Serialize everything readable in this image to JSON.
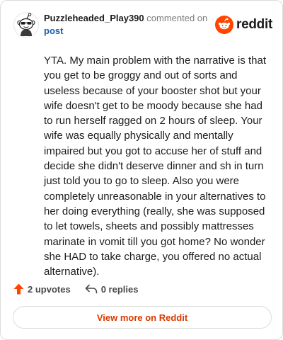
{
  "header": {
    "username": "Puzzleheaded_Play390",
    "commented_text": "commented on",
    "post_link": "post",
    "brand_name": "reddit"
  },
  "comment": {
    "body": "YTA. My main problem with the narrative is that you get to be groggy and out of sorts and useless because of your booster shot but your wife doesn't get to be moody because she had to run herself ragged on 2 hours of sleep. Your wife was equally physically and mentally impaired but you got to accuse her of stuff and decide she didn't deserve dinner and sh in turn just told you to go to sleep. Also you were completely unreasonable in your alternatives to her doing everything (really, she was supposed to let towels, sheets and possibly mattresses marinate in vomit till you got home? No wonder she HAD to take charge, you offered no actual alternative)."
  },
  "actions": {
    "upvotes_label": "2 upvotes",
    "replies_label": "0 replies"
  },
  "footer": {
    "view_more_label": "View more on Reddit"
  },
  "colors": {
    "brand_orange": "#ff4500",
    "link_blue": "#1c5fa8",
    "cta_orange": "#d93a00",
    "muted_gray": "#7c7c7c"
  },
  "icons": {
    "avatar": "snoo-avatar-with-sunglasses",
    "brand": "reddit-alien-icon",
    "upvote": "upvote-arrow-icon",
    "reply": "reply-arrow-icon"
  }
}
